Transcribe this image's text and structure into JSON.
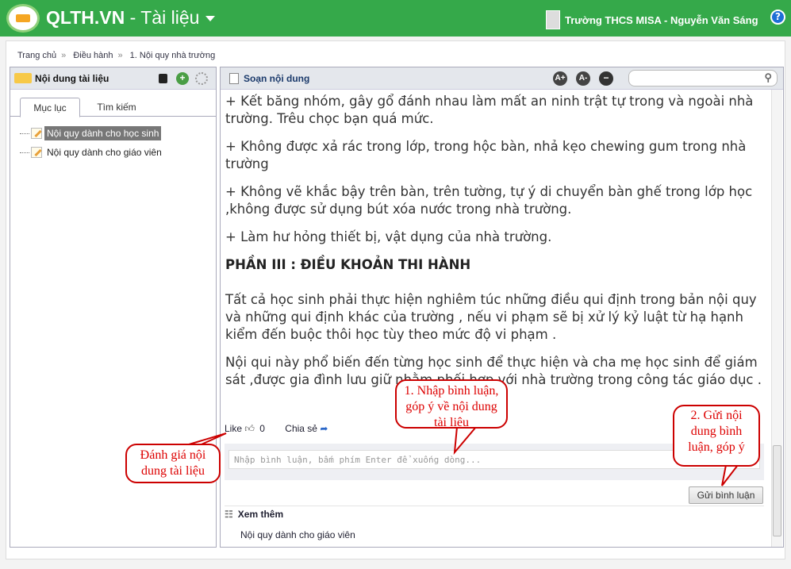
{
  "header": {
    "brand": "QLTH.VN",
    "section": "- Tài liệu",
    "user": "Trường THCS MISA - Nguyễn Văn Sáng",
    "help": "?"
  },
  "breadcrumb": [
    "Trang chủ",
    "Điều hành",
    "1. Nội quy nhà trường"
  ],
  "left_panel": {
    "title": "Nội dung tài liệu",
    "tabs": [
      "Mục lục",
      "Tìm kiếm"
    ],
    "tree": [
      "Nội quy dành cho học sinh",
      "Nội quy dành cho giáo viên"
    ]
  },
  "right_panel": {
    "title": "Soạn nội dung",
    "search_placeholder": ""
  },
  "content": {
    "paragraphs": [
      "+ Kết băng nhóm, gây gổ đánh nhau làm mất an ninh trật tự trong và ngoài nhà trường. Trêu chọc bạn quá mức.",
      "+ Không được xả rác trong lớp, trong hộc bàn, nhả kẹo chewing gum trong nhà trường",
      "+ Không vẽ khắc bậy trên bàn, trên tường, tự ý di chuyển bàn ghế trong lớp học ,không được sử dụng bút xóa nước trong nhà trường.",
      "+ Làm hư hỏng thiết bị, vật dụng của nhà trường."
    ],
    "heading": "PHẦN III : ĐIỀU KHOẢN THI HÀNH",
    "paragraphs2": [
      "Tất cả học sinh phải thực hiện nghiêm túc những điều qui định trong bản nội quy và những qui định khác của trường , nếu vi phạm sẽ bị xử lý kỷ luật từ hạ hạnh kiểm đến buộc thôi học tùy theo mức độ vi phạm .",
      "Nội qui này phổ biến đến từng học sinh để thực hiện và cha mẹ học sinh để giám sát ,được gia đình lưu giữ nhằm phối hợp với nhà trường trong công tác giáo dục ."
    ]
  },
  "social": {
    "like": "Like",
    "like_count": "0",
    "share": "Chia sẻ"
  },
  "comment": {
    "placeholder": "Nhập bình luận, bấm phím Enter để xuống dòng...",
    "send": "Gửi bình luận"
  },
  "see_more": {
    "title": "Xem thêm",
    "items": [
      "Nội quy dành cho giáo viên"
    ]
  },
  "callouts": [
    "1. Nhập bình luận, góp ý về nội dung tài liệu",
    "2. Gửi nội dung bình luận, góp ý",
    "Đánh giá nội dung tài liệu"
  ]
}
